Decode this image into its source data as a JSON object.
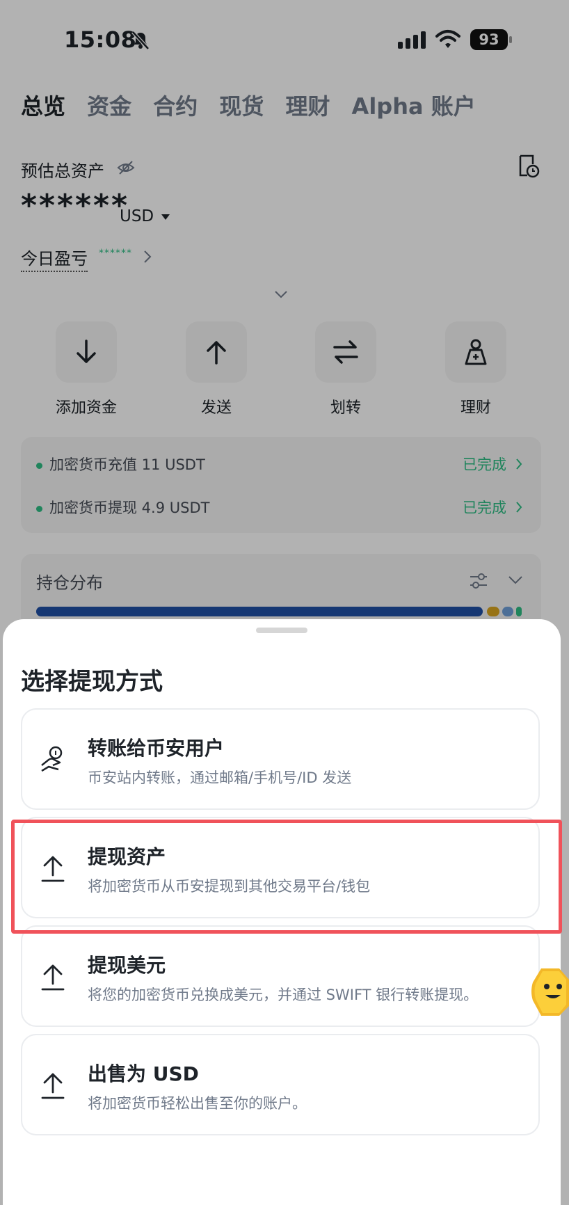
{
  "status_bar": {
    "time": "15:08",
    "battery": "93"
  },
  "tabs": [
    "总览",
    "资金",
    "合约",
    "现货",
    "理财",
    "Alpha 账户"
  ],
  "assets": {
    "label": "预估总资产",
    "total": "******",
    "currency": "USD",
    "pnl_label": "今日盈亏",
    "pnl_value": "******"
  },
  "actions": [
    {
      "label": "添加资金",
      "icon": "arrow-down-icon"
    },
    {
      "label": "发送",
      "icon": "arrow-up-icon"
    },
    {
      "label": "划转",
      "icon": "transfer-icon"
    },
    {
      "label": "理财",
      "icon": "earn-icon"
    }
  ],
  "records": [
    {
      "text": "加密货币充值 11 USDT",
      "status": "已完成"
    },
    {
      "text": "加密货币提现 4.9 USDT",
      "status": "已完成"
    }
  ],
  "holdings": {
    "title": "持仓分布",
    "bar_colors": [
      "#1f4fa5",
      "#d9a520",
      "#6f9fd8",
      "#2ebd85"
    ]
  },
  "sheet": {
    "title": "选择提现方式",
    "options": [
      {
        "title": "转账给币安用户",
        "desc": "币安站内转账，通过邮箱/手机号/ID 发送",
        "icon": "user-transfer-icon"
      },
      {
        "title": "提现资产",
        "desc": "将加密货币从币安提现到其他交易平台/钱包",
        "icon": "upload-icon"
      },
      {
        "title": "提现美元",
        "desc": "将您的加密货币兑换成美元，并通过 SWIFT 银行转账提现。",
        "icon": "upload-icon"
      },
      {
        "title": "出售为 USD",
        "desc": "将加密货币轻松出售至你的账户。",
        "icon": "upload-icon"
      }
    ]
  },
  "colors": {
    "accent_green": "#2ebd85",
    "highlight_red": "#f0525a"
  }
}
